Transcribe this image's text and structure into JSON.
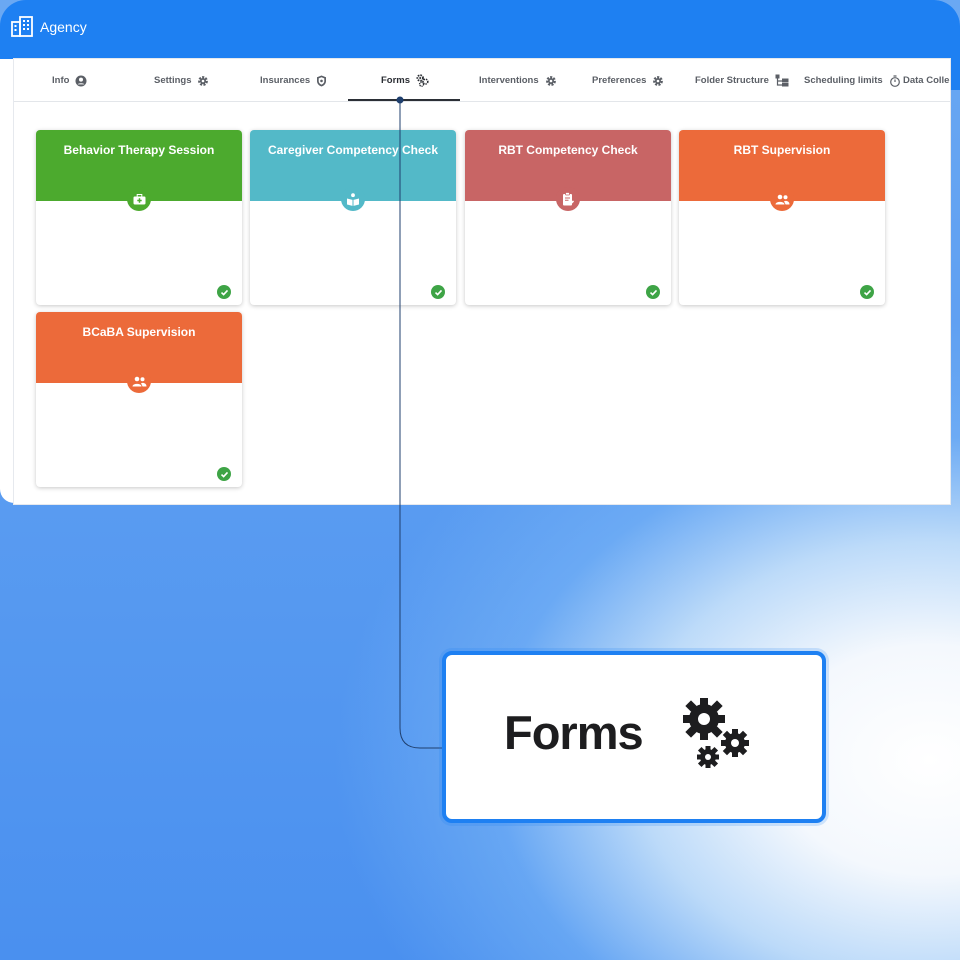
{
  "app": {
    "title": "Agency",
    "icon": "building-icon"
  },
  "tabs": [
    {
      "label": "Info",
      "icon": "account-circle-icon"
    },
    {
      "label": "Settings",
      "icon": "gear-icon"
    },
    {
      "label": "Insurances",
      "icon": "shield-icon"
    },
    {
      "label": "Forms",
      "icon": "gears-icon",
      "active": true
    },
    {
      "label": "Interventions",
      "icon": "gear-icon"
    },
    {
      "label": "Preferences",
      "icon": "gear-icon"
    },
    {
      "label": "Folder Structure",
      "icon": "folder-tree-icon"
    },
    {
      "label": "Scheduling limits",
      "icon": "stopwatch-icon"
    },
    {
      "label": "Data Collect",
      "icon": ""
    }
  ],
  "forms": [
    {
      "title": "Behavior Therapy Session",
      "color": "#4caa2e",
      "icon": "first-aid-kit-icon",
      "completed": true
    },
    {
      "title": "Caregiver Competency Check",
      "color": "#53b9c8",
      "icon": "reading-person-icon",
      "completed": true
    },
    {
      "title": "RBT Competency Check",
      "color": "#c86565",
      "icon": "clipboard-check-icon",
      "completed": true
    },
    {
      "title": "RBT Supervision",
      "color": "#ec6a3a",
      "icon": "people-icon",
      "completed": true
    },
    {
      "title": "BCaBA Supervision",
      "color": "#ec6a3a",
      "icon": "people-icon",
      "completed": true
    }
  ],
  "callout": {
    "label": "Forms",
    "icon": "gears-icon"
  },
  "colors": {
    "accent": "#1e80f2",
    "check": "#3ea446"
  }
}
